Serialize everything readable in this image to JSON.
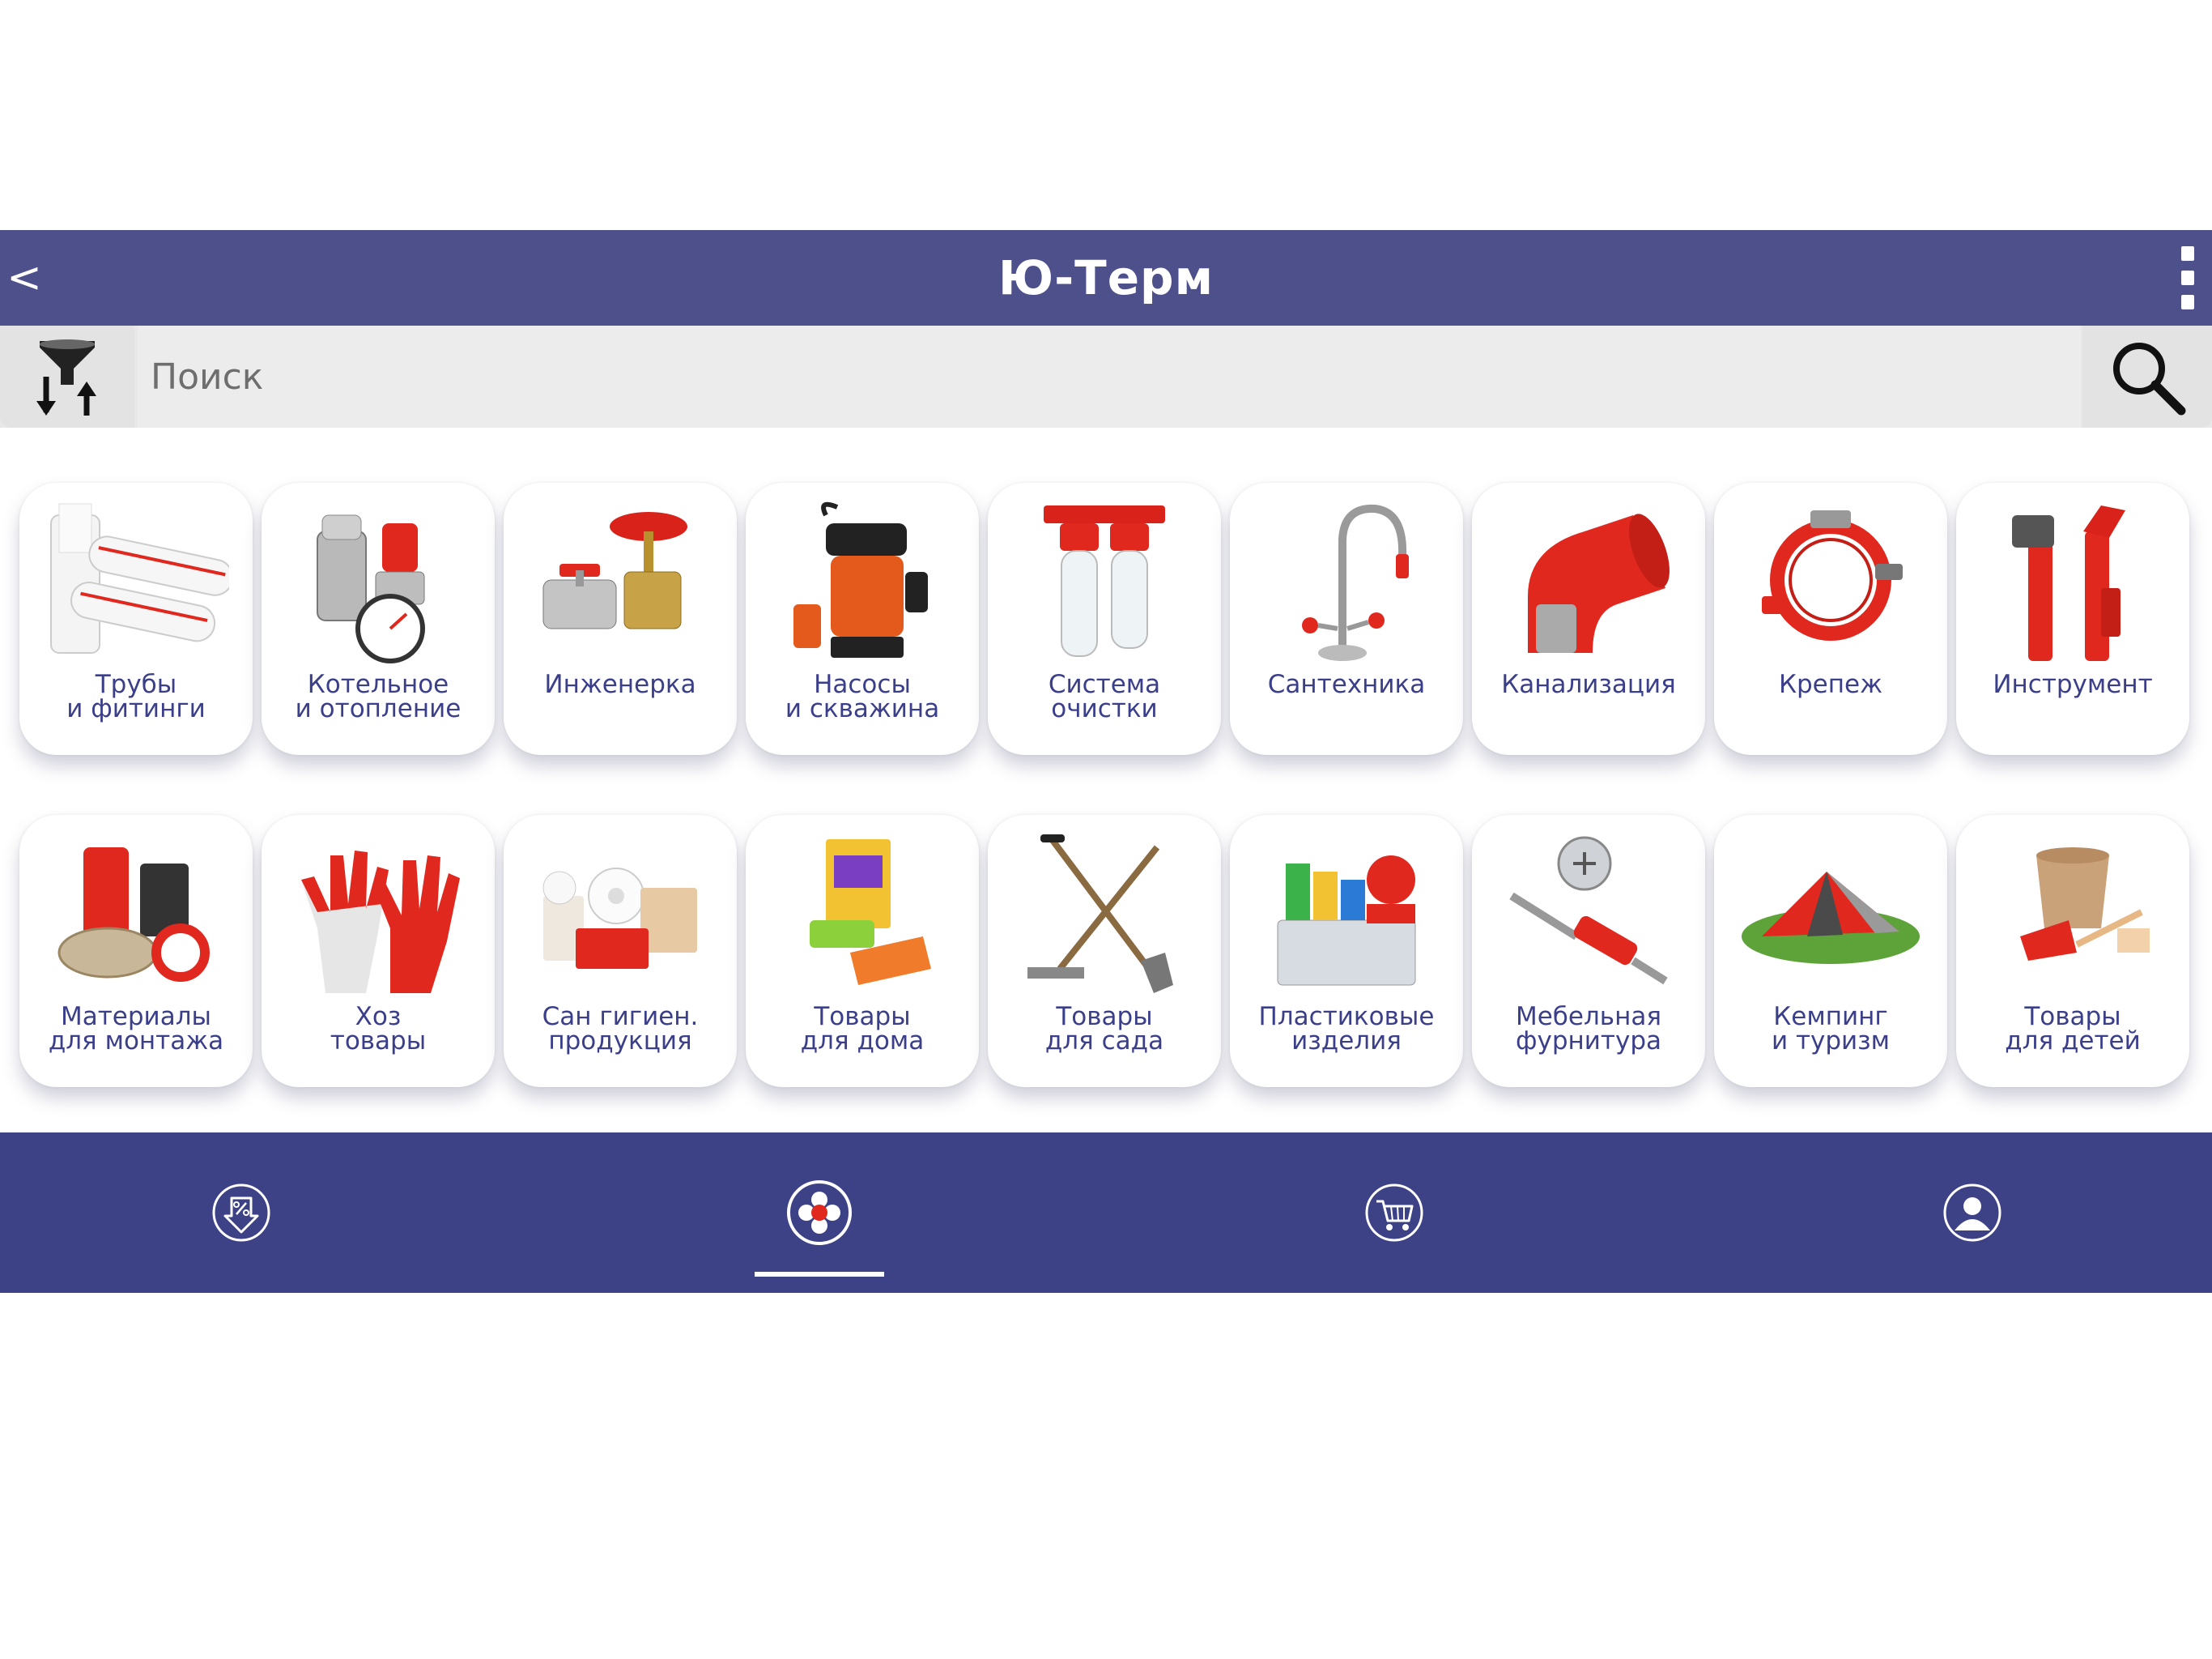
{
  "app_bar": {
    "back_label": "<",
    "title": "Ю-Терм"
  },
  "search": {
    "placeholder": "Поиск",
    "value": "",
    "filter_icon": "filter-sort-icon",
    "search_icon": "search-icon"
  },
  "categories": [
    {
      "label": "Трубы\nи фитинги",
      "icon": "pipes-icon"
    },
    {
      "label": "Котельное\nи отопление",
      "icon": "boiler-valve-icon"
    },
    {
      "label": "Инженерка",
      "icon": "gate-valve-icon"
    },
    {
      "label": "Насосы\nи скважина",
      "icon": "pump-icon"
    },
    {
      "label": "Система\nочистки",
      "icon": "water-filter-icon"
    },
    {
      "label": "Сантехника",
      "icon": "faucet-icon"
    },
    {
      "label": "Канализация",
      "icon": "sewer-elbow-icon"
    },
    {
      "label": "Крепеж",
      "icon": "pipe-clamp-icon"
    },
    {
      "label": "Инструмент",
      "icon": "pipe-wrench-icon"
    },
    {
      "label": "Материалы\nдля монтажа",
      "icon": "sealant-materials-icon"
    },
    {
      "label": "Хоз\nтовары",
      "icon": "gloves-icon"
    },
    {
      "label": "Сан гигиен.\nпродукция",
      "icon": "toilet-paper-icon"
    },
    {
      "label": "Товары\nдля дома",
      "icon": "household-goods-icon"
    },
    {
      "label": "Товары\nдля сада",
      "icon": "garden-tools-icon"
    },
    {
      "label": "Пластиковые\nизделия",
      "icon": "plastic-dishes-icon"
    },
    {
      "label": "Мебельная\nфурнитура",
      "icon": "furniture-fitting-icon"
    },
    {
      "label": "Кемпинг\nи туризм",
      "icon": "tent-icon"
    },
    {
      "label": "Товары\nдля детей",
      "icon": "bucket-toy-icon"
    }
  ],
  "bottom_nav": {
    "items": [
      {
        "icon": "discount-icon",
        "active": false
      },
      {
        "icon": "catalog-icon",
        "active": true
      },
      {
        "icon": "cart-icon",
        "active": false
      },
      {
        "icon": "profile-icon",
        "active": false
      }
    ]
  },
  "colors": {
    "app_bar": "#4e508c",
    "bottom_nav": "#3d4287",
    "label_text": "#3b3f8a",
    "accent_red": "#e0281e"
  }
}
